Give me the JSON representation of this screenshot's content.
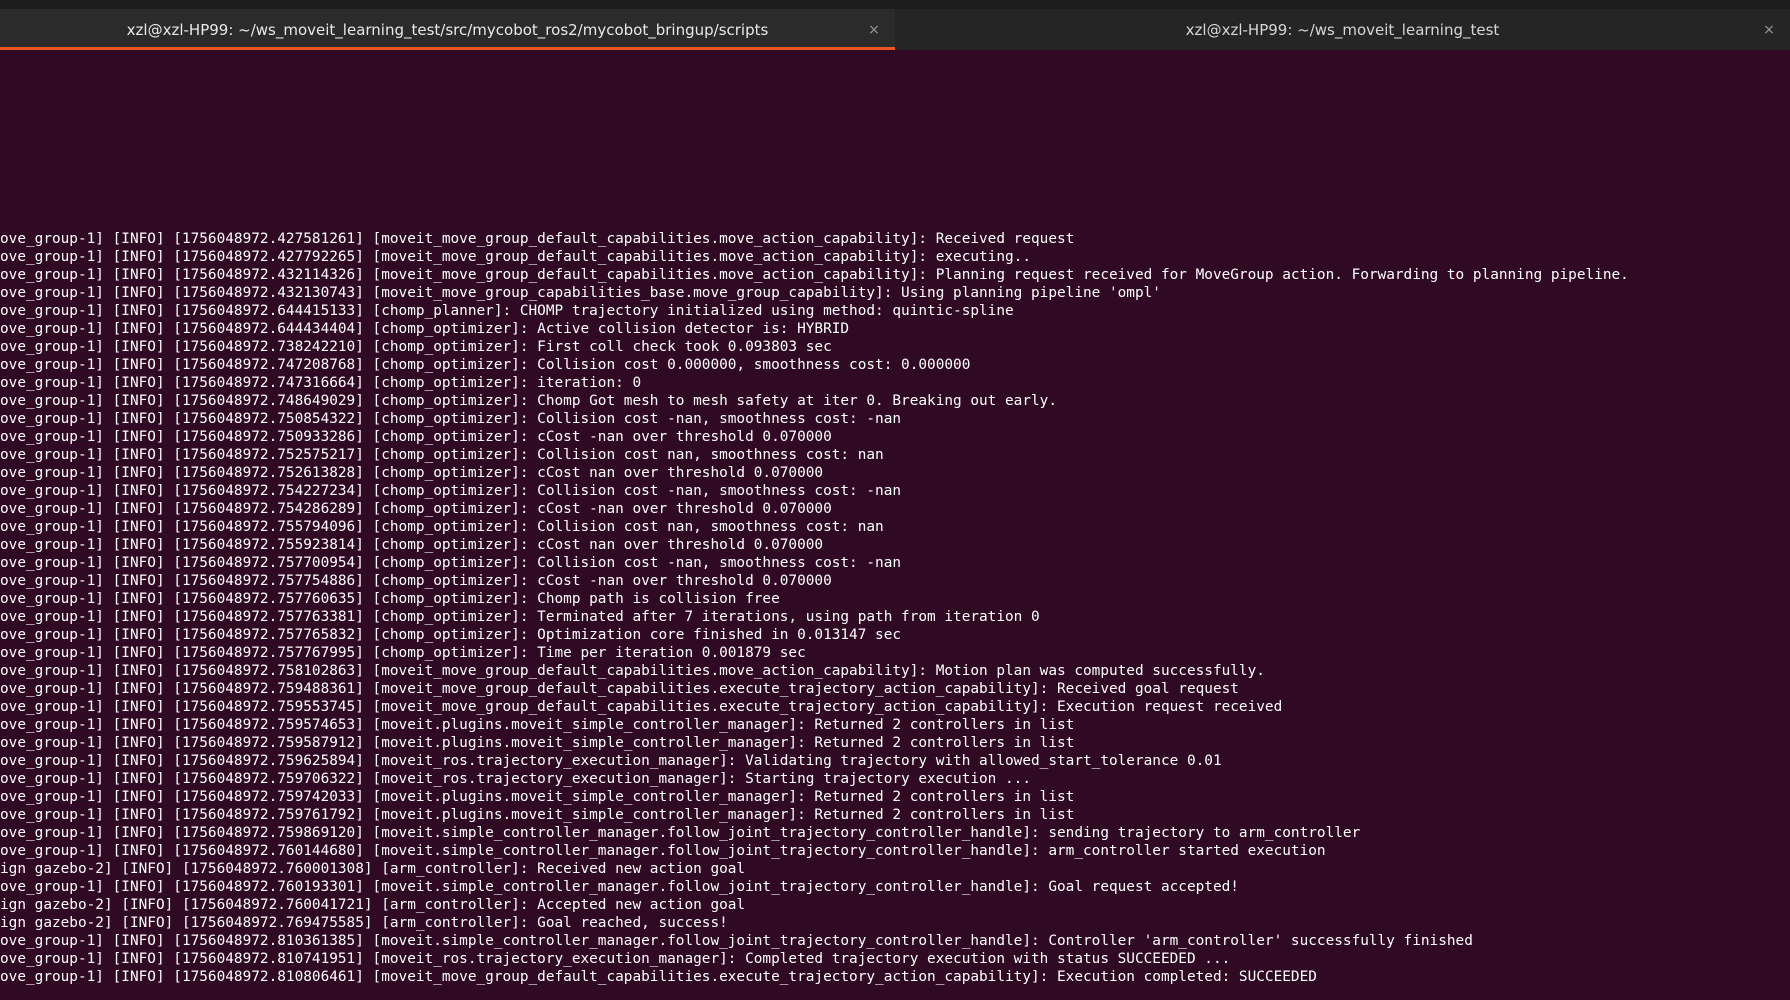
{
  "tabs": [
    {
      "title": "xzl@xzl-HP99: ~/ws_moveit_learning_test/src/mycobot_ros2/mycobot_bringup/scripts",
      "close": "×"
    },
    {
      "title": "xzl@xzl-HP99: ~/ws_moveit_learning_test",
      "close": "×"
    }
  ],
  "colors": {
    "terminal_bg": "#300a24",
    "active_tab_indicator": "#e95420",
    "text": "#ffffff"
  },
  "log_lines": [
    "ove_group-1] [INFO] [1756048972.427581261] [moveit_move_group_default_capabilities.move_action_capability]: Received request",
    "ove_group-1] [INFO] [1756048972.427792265] [moveit_move_group_default_capabilities.move_action_capability]: executing..",
    "ove_group-1] [INFO] [1756048972.432114326] [moveit_move_group_default_capabilities.move_action_capability]: Planning request received for MoveGroup action. Forwarding to planning pipeline.",
    "ove_group-1] [INFO] [1756048972.432130743] [moveit_move_group_capabilities_base.move_group_capability]: Using planning pipeline 'ompl'",
    "ove_group-1] [INFO] [1756048972.644415133] [chomp_planner]: CHOMP trajectory initialized using method: quintic-spline",
    "ove_group-1] [INFO] [1756048972.644434404] [chomp_optimizer]: Active collision detector is: HYBRID",
    "ove_group-1] [INFO] [1756048972.738242210] [chomp_optimizer]: First coll check took 0.093803 sec",
    "ove_group-1] [INFO] [1756048972.747208768] [chomp_optimizer]: Collision cost 0.000000, smoothness cost: 0.000000",
    "ove_group-1] [INFO] [1756048972.747316664] [chomp_optimizer]: iteration: 0",
    "ove_group-1] [INFO] [1756048972.748649029] [chomp_optimizer]: Chomp Got mesh to mesh safety at iter 0. Breaking out early.",
    "ove_group-1] [INFO] [1756048972.750854322] [chomp_optimizer]: Collision cost -nan, smoothness cost: -nan",
    "ove_group-1] [INFO] [1756048972.750933286] [chomp_optimizer]: cCost -nan over threshold 0.070000",
    "ove_group-1] [INFO] [1756048972.752575217] [chomp_optimizer]: Collision cost nan, smoothness cost: nan",
    "ove_group-1] [INFO] [1756048972.752613828] [chomp_optimizer]: cCost nan over threshold 0.070000",
    "ove_group-1] [INFO] [1756048972.754227234] [chomp_optimizer]: Collision cost -nan, smoothness cost: -nan",
    "ove_group-1] [INFO] [1756048972.754286289] [chomp_optimizer]: cCost -nan over threshold 0.070000",
    "ove_group-1] [INFO] [1756048972.755794096] [chomp_optimizer]: Collision cost nan, smoothness cost: nan",
    "ove_group-1] [INFO] [1756048972.755923814] [chomp_optimizer]: cCost nan over threshold 0.070000",
    "ove_group-1] [INFO] [1756048972.757700954] [chomp_optimizer]: Collision cost -nan, smoothness cost: -nan",
    "ove_group-1] [INFO] [1756048972.757754886] [chomp_optimizer]: cCost -nan over threshold 0.070000",
    "ove_group-1] [INFO] [1756048972.757760635] [chomp_optimizer]: Chomp path is collision free",
    "ove_group-1] [INFO] [1756048972.757763381] [chomp_optimizer]: Terminated after 7 iterations, using path from iteration 0",
    "ove_group-1] [INFO] [1756048972.757765832] [chomp_optimizer]: Optimization core finished in 0.013147 sec",
    "ove_group-1] [INFO] [1756048972.757767995] [chomp_optimizer]: Time per iteration 0.001879 sec",
    "ove_group-1] [INFO] [1756048972.758102863] [moveit_move_group_default_capabilities.move_action_capability]: Motion plan was computed successfully.",
    "ove_group-1] [INFO] [1756048972.759488361] [moveit_move_group_default_capabilities.execute_trajectory_action_capability]: Received goal request",
    "ove_group-1] [INFO] [1756048972.759553745] [moveit_move_group_default_capabilities.execute_trajectory_action_capability]: Execution request received",
    "ove_group-1] [INFO] [1756048972.759574653] [moveit.plugins.moveit_simple_controller_manager]: Returned 2 controllers in list",
    "ove_group-1] [INFO] [1756048972.759587912] [moveit.plugins.moveit_simple_controller_manager]: Returned 2 controllers in list",
    "ove_group-1] [INFO] [1756048972.759625894] [moveit_ros.trajectory_execution_manager]: Validating trajectory with allowed_start_tolerance 0.01",
    "ove_group-1] [INFO] [1756048972.759706322] [moveit_ros.trajectory_execution_manager]: Starting trajectory execution ...",
    "ove_group-1] [INFO] [1756048972.759742033] [moveit.plugins.moveit_simple_controller_manager]: Returned 2 controllers in list",
    "ove_group-1] [INFO] [1756048972.759761792] [moveit.plugins.moveit_simple_controller_manager]: Returned 2 controllers in list",
    "ove_group-1] [INFO] [1756048972.759869120] [moveit.simple_controller_manager.follow_joint_trajectory_controller_handle]: sending trajectory to arm_controller",
    "ove_group-1] [INFO] [1756048972.760144680] [moveit.simple_controller_manager.follow_joint_trajectory_controller_handle]: arm_controller started execution",
    "ign gazebo-2] [INFO] [1756048972.760001308] [arm_controller]: Received new action goal",
    "ove_group-1] [INFO] [1756048972.760193301] [moveit.simple_controller_manager.follow_joint_trajectory_controller_handle]: Goal request accepted!",
    "ign gazebo-2] [INFO] [1756048972.760041721] [arm_controller]: Accepted new action goal",
    "ign gazebo-2] [INFO] [1756048972.769475585] [arm_controller]: Goal reached, success!",
    "ove_group-1] [INFO] [1756048972.810361385] [moveit.simple_controller_manager.follow_joint_trajectory_controller_handle]: Controller 'arm_controller' successfully finished",
    "ove_group-1] [INFO] [1756048972.810741951] [moveit_ros.trajectory_execution_manager]: Completed trajectory execution with status SUCCEEDED ...",
    "ove_group-1] [INFO] [1756048972.810806461] [moveit_move_group_default_capabilities.execute_trajectory_action_capability]: Execution completed: SUCCEEDED"
  ]
}
